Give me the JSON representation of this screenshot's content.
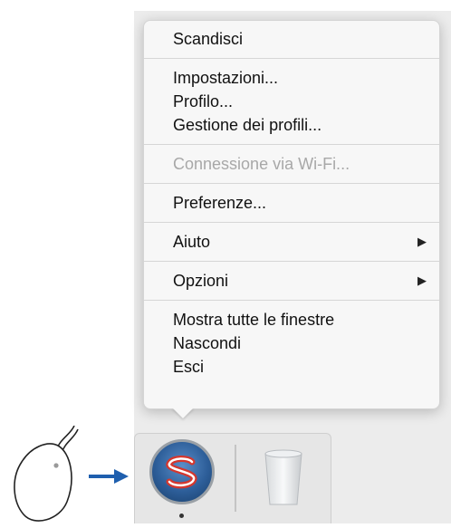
{
  "context_menu": {
    "groups": [
      [
        {
          "label": "Scandisci",
          "enabled": true
        }
      ],
      [
        {
          "label": "Impostazioni...",
          "enabled": true
        },
        {
          "label": "Profilo...",
          "enabled": true
        },
        {
          "label": "Gestione dei profili...",
          "enabled": true
        }
      ],
      [
        {
          "label": "Connessione via Wi-Fi...",
          "enabled": false
        }
      ],
      [
        {
          "label": "Preferenze...",
          "enabled": true
        }
      ],
      [
        {
          "label": "Aiuto",
          "enabled": true,
          "submenu": true
        }
      ],
      [
        {
          "label": "Opzioni",
          "enabled": true,
          "submenu": true
        }
      ],
      [
        {
          "label": "Mostra tutte le finestre",
          "enabled": true
        },
        {
          "label": "Nascondi",
          "enabled": true
        },
        {
          "label": "Esci",
          "enabled": true
        }
      ]
    ],
    "submenu_arrow": "▶"
  },
  "dock": {
    "items": [
      {
        "icon": "scansnap-app-icon",
        "running": true
      },
      {
        "icon": "trash-icon",
        "running": false
      }
    ]
  },
  "annotation": {
    "icons": [
      "mouse-icon",
      "blue-arrow-icon"
    ],
    "arrow_color": "#1f5fae"
  },
  "colors": {
    "menu_bg": "#f7f7f7",
    "disabled_text": "#a8a8a8",
    "app_blue": "#2d5e99",
    "app_red": "#d4372e"
  }
}
